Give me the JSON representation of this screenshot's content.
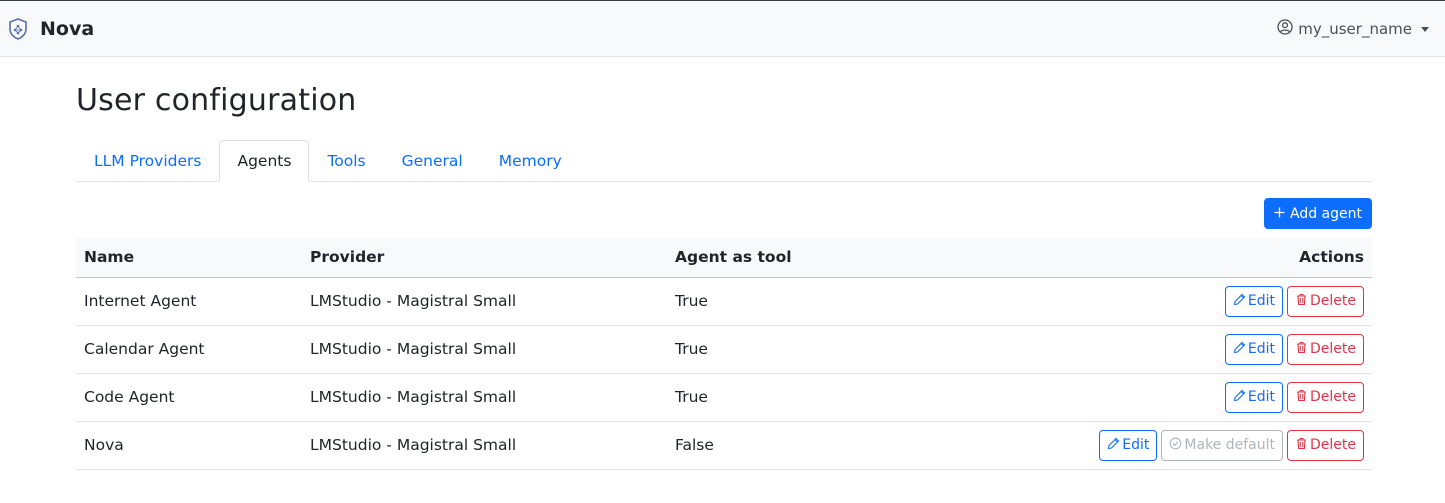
{
  "navbar": {
    "brand_name": "Nova",
    "user_name": "my_user_name",
    "logo_icon": "shield-network-icon",
    "user_icon": "person-circle-icon"
  },
  "page": {
    "title": "User configuration"
  },
  "tabs": [
    {
      "label": "LLM Providers",
      "active": false
    },
    {
      "label": "Agents",
      "active": true
    },
    {
      "label": "Tools",
      "active": false
    },
    {
      "label": "General",
      "active": false
    },
    {
      "label": "Memory",
      "active": false
    }
  ],
  "toolbar": {
    "add_label": "Add agent",
    "add_icon": "plus-icon"
  },
  "table": {
    "headers": {
      "name": "Name",
      "provider": "Provider",
      "agent_as_tool": "Agent as tool",
      "actions": "Actions"
    },
    "rows": [
      {
        "name": "Internet Agent",
        "provider": "LMStudio - Magistral Small",
        "agent_as_tool": "True",
        "edit": "Edit",
        "delete": "Delete"
      },
      {
        "name": "Calendar Agent",
        "provider": "LMStudio - Magistral Small",
        "agent_as_tool": "True",
        "edit": "Edit",
        "delete": "Delete"
      },
      {
        "name": "Code Agent",
        "provider": "LMStudio - Magistral Small",
        "agent_as_tool": "True",
        "edit": "Edit",
        "delete": "Delete"
      },
      {
        "name": "Nova",
        "provider": "LMStudio - Magistral Small",
        "agent_as_tool": "False",
        "edit": "Edit",
        "make_default": "Make default",
        "delete": "Delete"
      }
    ]
  },
  "colors": {
    "primary": "#0d6efd",
    "danger": "#dc3545",
    "disabled": "#adb5bd"
  }
}
